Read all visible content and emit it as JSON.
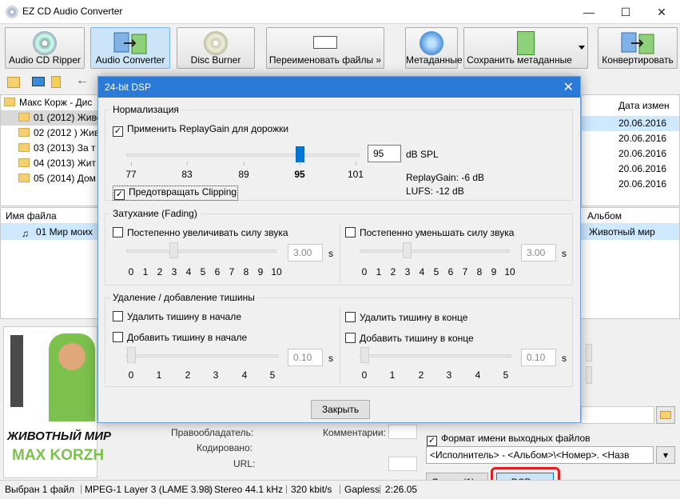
{
  "window": {
    "title": "EZ CD Audio Converter",
    "min": "—",
    "max": "☐",
    "close": "✕"
  },
  "toolbar": {
    "ripper": "Audio CD Ripper",
    "converter": "Audio Converter",
    "burner": "Disc Burner",
    "rename": "Переименовать файлы »",
    "meta": "Метаданные",
    "save_meta": "Сохранить метаданные",
    "convert": "Конвертировать"
  },
  "tree": {
    "root": "Макс Корж - Дис",
    "items": [
      "01 (2012) Живо",
      "02 (2012 ) Жив",
      "03 (2013) За т",
      "04 (2013) Жит",
      "05 (2014) Дом"
    ]
  },
  "right_list": {
    "header": "Дата измен",
    "dates": [
      "20.06.2016",
      "20.06.2016",
      "20.06.2016",
      "20.06.2016",
      "20.06.2016"
    ]
  },
  "files": {
    "col_name": "Имя файла",
    "col_album": "Альбом",
    "row_name": "01 Мир моих",
    "row_album": "Животный мир"
  },
  "cover": {
    "line1": "ЖИВОТНЫЙ МИР",
    "line2": "MAX KORZH"
  },
  "metadata": {
    "copyright": "Правообладатель:",
    "comments": "Комментарии:",
    "encoded": "Кодировано:",
    "url": "URL:"
  },
  "output": {
    "format_label": "Формат имени выходных файлов",
    "format_value": "<Исполнитель> - <Альбом>\\<Номер>. <Назв",
    "options_btn": "Опции (1) »",
    "dsp_btn": "DSP »"
  },
  "status": {
    "selected": "Выбран 1 файл",
    "codec": "MPEG-1 Layer 3 (LAME 3.98)",
    "stereo": "Stereo 44.1 kHz",
    "bitrate": "320 kbit/s",
    "gapless": "Gapless",
    "duration": "2:26.05"
  },
  "dialog": {
    "title": "24-bit DSP",
    "close": "✕",
    "norm": {
      "group": "Нормализация",
      "apply": "Применить ReplayGain для дорожки",
      "apply_checked": "✓",
      "value": "95",
      "unit": "dB SPL",
      "ticks": [
        "77",
        "83",
        "89",
        "95",
        "101"
      ],
      "rg": "ReplayGain:  -6 dB",
      "lufs": "LUFS:  -12 dB",
      "prevent": "Предотвращать Clipping",
      "prevent_checked": "✓"
    },
    "fade": {
      "group": "Затухание (Fading)",
      "in": "Постепенно увеличивать силу звука",
      "out": "Постепенно уменьшать силу звука",
      "in_value": "3.00",
      "out_value": "3.00",
      "unit": "s",
      "ticks": [
        "0",
        "1",
        "2",
        "3",
        "4",
        "5",
        "6",
        "7",
        "8",
        "9",
        "10"
      ]
    },
    "silence": {
      "group": "Удаление / добавление тишины",
      "rm_start": "Удалить тишину в начале",
      "add_start": "Добавить тишину в начале",
      "rm_end": "Удалить тишину в конце",
      "add_end": "Добавить тишину в конце",
      "start_value": "0.10",
      "end_value": "0.10",
      "unit": "s",
      "ticks": [
        "0",
        "1",
        "2",
        "3",
        "4",
        "5"
      ]
    },
    "close_btn": "Закрыть"
  },
  "colors": {
    "accent": "#2b7ad8",
    "highlight": "#e02020"
  }
}
